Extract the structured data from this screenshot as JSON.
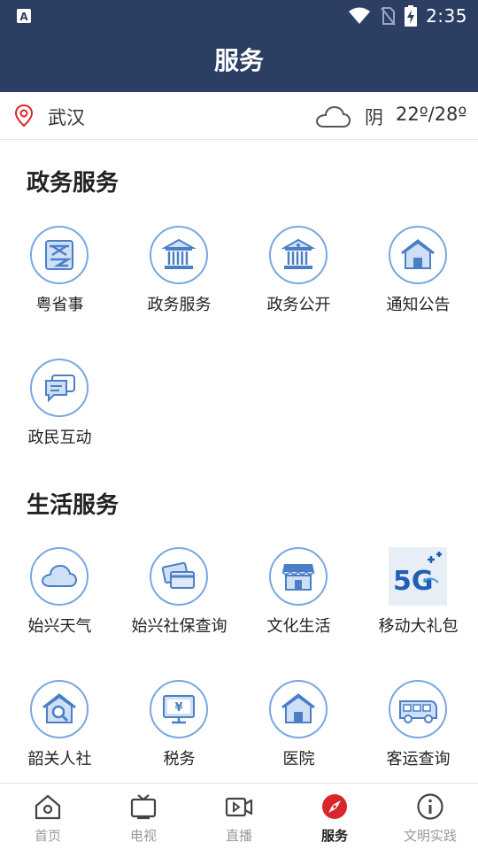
{
  "status_bar": {
    "time": "2:35"
  },
  "title": "服务",
  "location_bar": {
    "city": "武汉",
    "weather": "阴",
    "temperature": "22º/28º"
  },
  "sections": [
    {
      "title": "政务服务",
      "items": [
        {
          "label": "粤省事",
          "icon": "yue-sheng-shi-icon"
        },
        {
          "label": "政务服务",
          "icon": "government-building-icon"
        },
        {
          "label": "政务公开",
          "icon": "government-building-icon"
        },
        {
          "label": "通知公告",
          "icon": "house-icon"
        },
        {
          "label": "政民互动",
          "icon": "chat-bubbles-icon"
        }
      ]
    },
    {
      "title": "生活服务",
      "items": [
        {
          "label": "始兴天气",
          "icon": "cloud-icon"
        },
        {
          "label": "始兴社保查询",
          "icon": "cards-icon"
        },
        {
          "label": "文化生活",
          "icon": "storefront-icon"
        },
        {
          "label": "移动大礼包",
          "icon": "5g-logo-icon"
        },
        {
          "label": "韶关人社",
          "icon": "house-search-icon"
        },
        {
          "label": "税务",
          "icon": "monitor-yen-icon"
        },
        {
          "label": "医院",
          "icon": "house-icon"
        },
        {
          "label": "客运查询",
          "icon": "bus-icon"
        }
      ]
    }
  ],
  "tabs": [
    {
      "label": "首页",
      "icon": "home-icon",
      "active": false
    },
    {
      "label": "电视",
      "icon": "tv-icon",
      "active": false
    },
    {
      "label": "直播",
      "icon": "video-camera-icon",
      "active": false
    },
    {
      "label": "服务",
      "icon": "compass-icon",
      "active": true
    },
    {
      "label": "文明实践",
      "icon": "info-icon",
      "active": false
    }
  ],
  "colors": {
    "header": "#2c3e63",
    "icon_accent": "#7aa7e0",
    "active_tab": "#d9262a"
  }
}
